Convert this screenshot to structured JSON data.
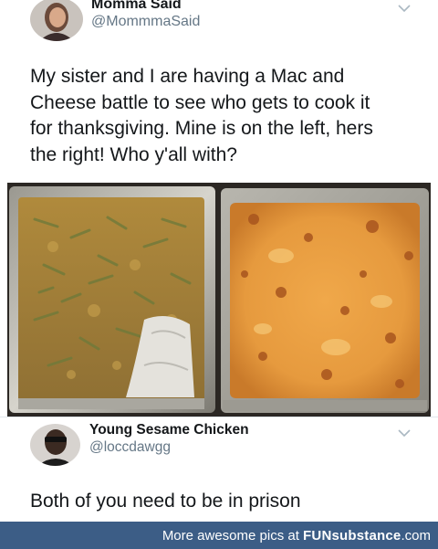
{
  "tweet": {
    "author_name": "Momma Said",
    "author_handle": "@MommmaSaid",
    "text_lines": [
      "My sister and I are having a Mac and",
      "Cheese battle to see who gets to cook it",
      "for thanksgiving. Mine is on the left, hers",
      "the right! Who y'all with?"
    ],
    "menu_icon": "chevron-down-icon"
  },
  "photo": {
    "left_label": "left pan of mac and cheese with green beans",
    "right_label": "right pan of baked mac and cheese"
  },
  "reply": {
    "author_name": "Young Sesame Chicken",
    "author_handle": "@loccdawgg",
    "text": "Both of you need to be in prison",
    "menu_icon": "chevron-down-icon"
  },
  "footer": {
    "prefix": "More awesome pics at ",
    "brand_bold": "FUNsubstance",
    "brand_suffix": ".com",
    "background": "#3c5d86"
  }
}
